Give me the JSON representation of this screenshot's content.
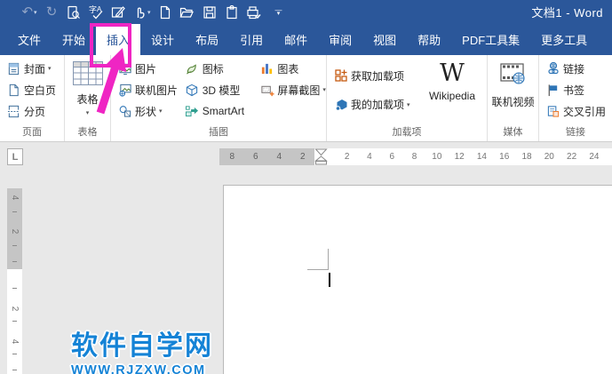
{
  "colors": {
    "titlebar": "#2B579A",
    "accent_magenta": "#EF25C3",
    "watermark_blue": "#1583D6",
    "ribbon_bg": "#FFFFFF"
  },
  "titlebar": {
    "title": "文档1 - Word",
    "qat_icons": [
      "undo-icon",
      "redo-icon",
      "print-preview-icon",
      "spellcheck-icon",
      "draft-edit-icon",
      "touch-mode-icon",
      "new-document-icon",
      "open-icon",
      "save-icon",
      "attachment-icon",
      "quick-print-icon",
      "customize-qat-icon"
    ]
  },
  "tabs": {
    "items": [
      {
        "label": "文件"
      },
      {
        "label": "开始"
      },
      {
        "label": "插入",
        "active": true
      },
      {
        "label": "设计"
      },
      {
        "label": "布局"
      },
      {
        "label": "引用"
      },
      {
        "label": "邮件"
      },
      {
        "label": "审阅"
      },
      {
        "label": "视图"
      },
      {
        "label": "帮助"
      },
      {
        "label": "PDF工具集"
      },
      {
        "label": "更多工具"
      }
    ]
  },
  "ribbon": {
    "pages": {
      "label": "页面",
      "items": [
        "封面",
        "空白页",
        "分页"
      ],
      "icons": [
        "cover-page-icon",
        "blank-page-icon",
        "page-break-icon"
      ]
    },
    "tables": {
      "label": "表格",
      "button_label": "表格",
      "icon": "table-icon"
    },
    "illustrations": {
      "label": "插图",
      "col1": [
        "图片",
        "联机图片",
        "形状"
      ],
      "col1_icons": [
        "picture-icon",
        "online-picture-icon",
        "shapes-icon"
      ],
      "col2": [
        "图标",
        "3D 模型",
        "SmartArt"
      ],
      "col2_icons": [
        "icons-icon",
        "3d-model-icon",
        "smartart-icon"
      ],
      "col3": [
        "图表",
        "屏幕截图"
      ],
      "col3_icons": [
        "chart-icon",
        "screenshot-icon"
      ]
    },
    "addins": {
      "label": "加载项",
      "items": [
        "获取加载项",
        "我的加载项"
      ],
      "icons": [
        "get-addins-icon",
        "my-addins-icon"
      ],
      "wikipedia": "Wikipedia"
    },
    "media": {
      "label": "媒体",
      "button": "联机视频",
      "icon": "online-video-icon"
    },
    "links": {
      "label": "链接",
      "items": [
        "链接",
        "书签",
        "交叉引用"
      ],
      "icons": [
        "link-icon",
        "bookmark-icon",
        "cross-reference-icon"
      ]
    }
  },
  "ruler": {
    "tab_selector": "L",
    "h_margin": [
      "8",
      "6",
      "4",
      "2"
    ],
    "h_main": [
      "2",
      "4",
      "6",
      "8",
      "10",
      "12",
      "14",
      "16",
      "18",
      "20",
      "22",
      "24"
    ],
    "v_margin": [
      "4",
      "2"
    ],
    "v_main": [
      "2",
      "4"
    ]
  },
  "watermark": {
    "line1": "软件自学网",
    "line2": "WWW.RJZXW.COM"
  },
  "ui": {
    "caret": "▾",
    "undo_glyph": "↶",
    "redo_glyph": "↻",
    "qat_bar": "—"
  }
}
